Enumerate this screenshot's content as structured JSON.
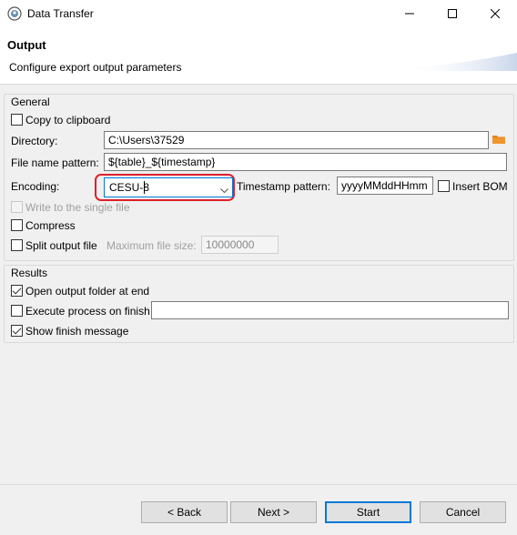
{
  "window": {
    "title": "Data Transfer"
  },
  "header": {
    "title": "Output",
    "description": "Configure export output parameters"
  },
  "general": {
    "title": "General",
    "copy_to_clipboard": {
      "label": "Copy to clipboard",
      "checked": false
    },
    "directory": {
      "label": "Directory:",
      "value": "C:\\Users\\37529"
    },
    "file_name_pattern": {
      "label": "File name pattern:",
      "value": "${table}_${timestamp}"
    },
    "encoding": {
      "label": "Encoding:",
      "value": "CESU-8"
    },
    "timestamp_pattern": {
      "label": "Timestamp pattern:",
      "value": "yyyyMMddHHmm"
    },
    "insert_bom": {
      "label": "Insert BOM",
      "checked": false
    },
    "write_single_file": {
      "label": "Write to the single file",
      "checked": false,
      "enabled": false
    },
    "compress": {
      "label": "Compress",
      "checked": false
    },
    "split_output": {
      "label": "Split output file",
      "checked": false
    },
    "max_file_size": {
      "label": "Maximum file size:",
      "value": "10000000"
    }
  },
  "results": {
    "title": "Results",
    "open_folder": {
      "label": "Open output folder at end",
      "checked": true
    },
    "execute_process": {
      "label": "Execute process on finish",
      "checked": false,
      "value": ""
    },
    "show_finish": {
      "label": "Show finish message",
      "checked": true
    }
  },
  "buttons": {
    "back": "< Back",
    "next": "Next >",
    "start": "Start",
    "cancel": "Cancel"
  },
  "colors": {
    "highlight": "#e0202a",
    "folder_icon": "#e8821e",
    "default_button_border": "#0078d7"
  }
}
